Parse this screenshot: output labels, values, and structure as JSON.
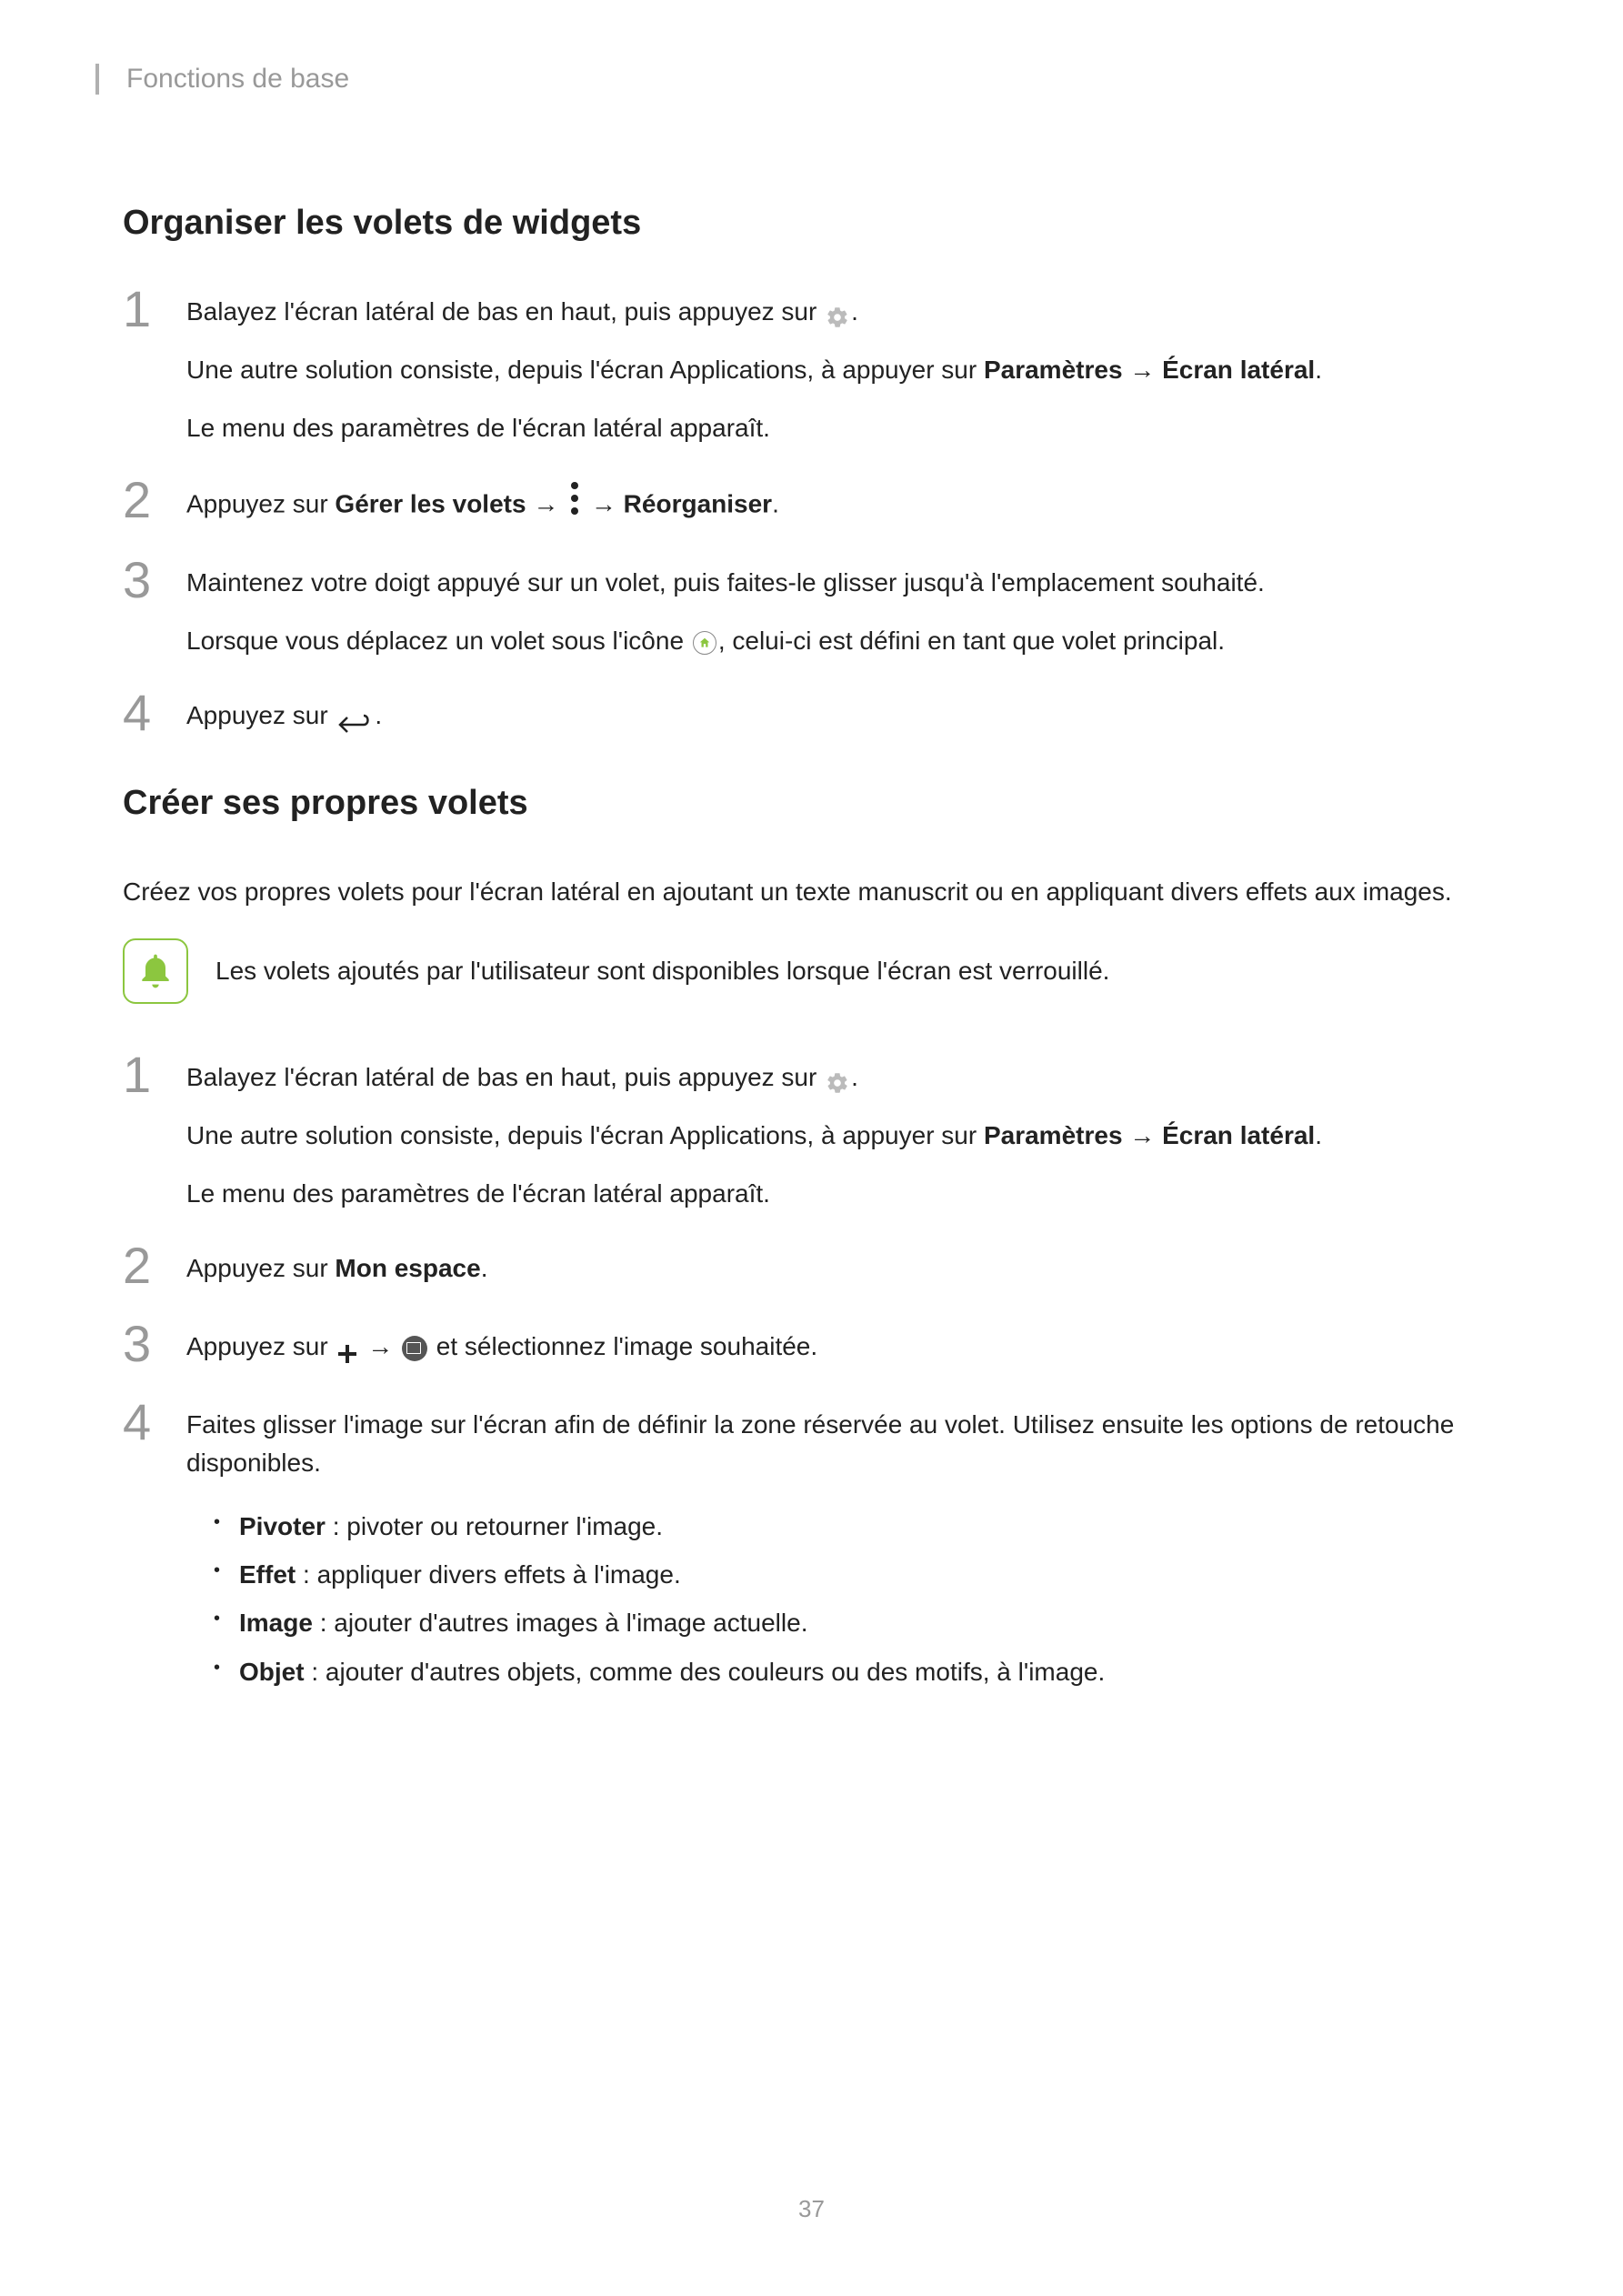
{
  "header": {
    "breadcrumb": "Fonctions de base"
  },
  "section1": {
    "title": "Organiser les volets de widgets",
    "steps": [
      {
        "num": "1",
        "line1_a": "Balayez l'écran latéral de bas en haut, puis appuyez sur ",
        "line1_b": ".",
        "line2_a": "Une autre solution consiste, depuis l'écran Applications, à appuyer sur ",
        "line2_bold1": "Paramètres",
        "line2_arrow": " → ",
        "line2_bold2": "Écran latéral",
        "line2_b": ".",
        "line3": "Le menu des paramètres de l'écran latéral apparaît."
      },
      {
        "num": "2",
        "line1_a": "Appuyez sur ",
        "line1_bold1": "Gérer les volets",
        "line1_arrow1": " → ",
        "line1_arrow2": " → ",
        "line1_bold2": "Réorganiser",
        "line1_b": "."
      },
      {
        "num": "3",
        "line1": "Maintenez votre doigt appuyé sur un volet, puis faites-le glisser jusqu'à l'emplacement souhaité.",
        "line2_a": "Lorsque vous déplacez un volet sous l'icône ",
        "line2_b": ", celui-ci est défini en tant que volet principal."
      },
      {
        "num": "4",
        "line1_a": "Appuyez sur ",
        "line1_b": "."
      }
    ]
  },
  "section2": {
    "title": "Créer ses propres volets",
    "intro": "Créez vos propres volets pour l'écran latéral en ajoutant un texte manuscrit ou en appliquant divers effets aux images.",
    "note": "Les volets ajoutés par l'utilisateur sont disponibles lorsque l'écran est verrouillé.",
    "steps": [
      {
        "num": "1",
        "line1_a": "Balayez l'écran latéral de bas en haut, puis appuyez sur ",
        "line1_b": ".",
        "line2_a": "Une autre solution consiste, depuis l'écran Applications, à appuyer sur ",
        "line2_bold1": "Paramètres",
        "line2_arrow": " → ",
        "line2_bold2": "Écran latéral",
        "line2_b": ".",
        "line3": "Le menu des paramètres de l'écran latéral apparaît."
      },
      {
        "num": "2",
        "line1_a": "Appuyez sur ",
        "line1_bold": "Mon espace",
        "line1_b": "."
      },
      {
        "num": "3",
        "line1_a": "Appuyez sur ",
        "line1_arrow": " → ",
        "line1_b": " et sélectionnez l'image souhaitée."
      },
      {
        "num": "4",
        "line1": "Faites glisser l'image sur l'écran afin de définir la zone réservée au volet. Utilisez ensuite les options de retouche disponibles.",
        "bullets": [
          {
            "bold": "Pivoter",
            "text": " : pivoter ou retourner l'image."
          },
          {
            "bold": "Effet",
            "text": " : appliquer divers effets à l'image."
          },
          {
            "bold": "Image",
            "text": " : ajouter d'autres images à l'image actuelle."
          },
          {
            "bold": "Objet",
            "text": " : ajouter d'autres objets, comme des couleurs ou des motifs, à l'image."
          }
        ]
      }
    ]
  },
  "pageNumber": "37"
}
